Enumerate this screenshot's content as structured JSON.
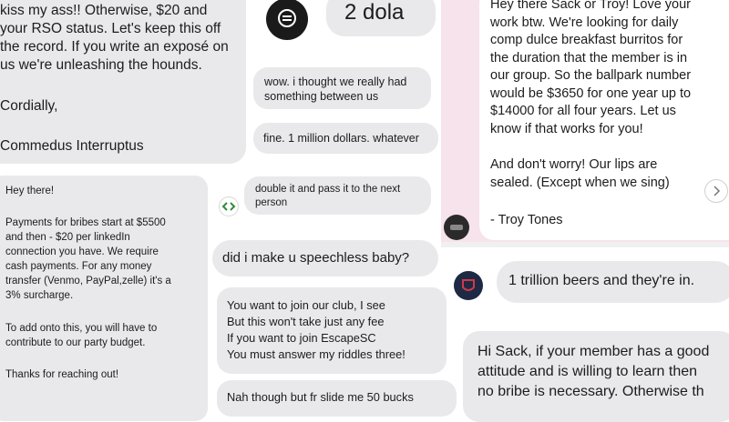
{
  "panel_top_left": {
    "lines": [
      "kiss my ass!! Otherwise, $20 and",
      "your RSO status. Let's keep this off",
      "the record. If you write an exposé on",
      "us we're unleashing the hounds."
    ],
    "closing": "Cordially,",
    "signature": "Commedus Interruptus"
  },
  "panel_bottom_left": {
    "greeting": "Hey there!",
    "paragraph1": [
      "Payments for bribes start at $5500",
      "and then - $20 per linkedIn",
      "connection you have. We require",
      "cash payments. For any money",
      "transfer (Venmo, PayPal,zelle) it's a",
      "3% surcharge."
    ],
    "paragraph2": [
      "To add onto this, you will have to",
      "contribute to our party budget."
    ],
    "thanks": "Thanks for reaching out!"
  },
  "panel_middle_top": {
    "header_text": "2 dola",
    "msg1": [
      "wow. i thought we really had",
      "something between us"
    ],
    "msg2": "fine. 1 million dollars. whatever",
    "msg3": [
      "double it and pass it to the next",
      "person"
    ]
  },
  "panel_middle_bottom": {
    "msg1": "did i make u speechless baby?",
    "riddle": [
      "You want to join our club, I see",
      "But this won't take just any fee",
      "If you want to join EscapeSC",
      "You must answer my riddles three!"
    ],
    "msg3": "Nah though but fr slide me 50 bucks"
  },
  "panel_top_right": {
    "lines": [
      "Hey there Sack or Troy! Love your",
      "work btw. We're looking for daily",
      "comp dulce breakfast burritos for",
      "the duration that the member is in",
      "our group. So the ballpark number",
      "would be $3650 for one year up to",
      "$14000 for all four years. Let us",
      "know if that works for you!"
    ],
    "para2": [
      "And don't worry! Our lips are",
      "sealed. (Except when we sing)"
    ],
    "signature": "- Troy Tones",
    "next_icon": "chevron-right-icon"
  },
  "panel_bottom_right": {
    "msg1": "1 trillion beers and they're in.",
    "msg2": [
      "Hi Sack, if your member has a good",
      "attitude and is willing to learn then",
      "no bribe is necessary. Otherwise th"
    ]
  },
  "colors": {
    "bubble": "#e9e9eb",
    "pink_panel": "#f7e3ec",
    "text": "#1c1c1e"
  }
}
